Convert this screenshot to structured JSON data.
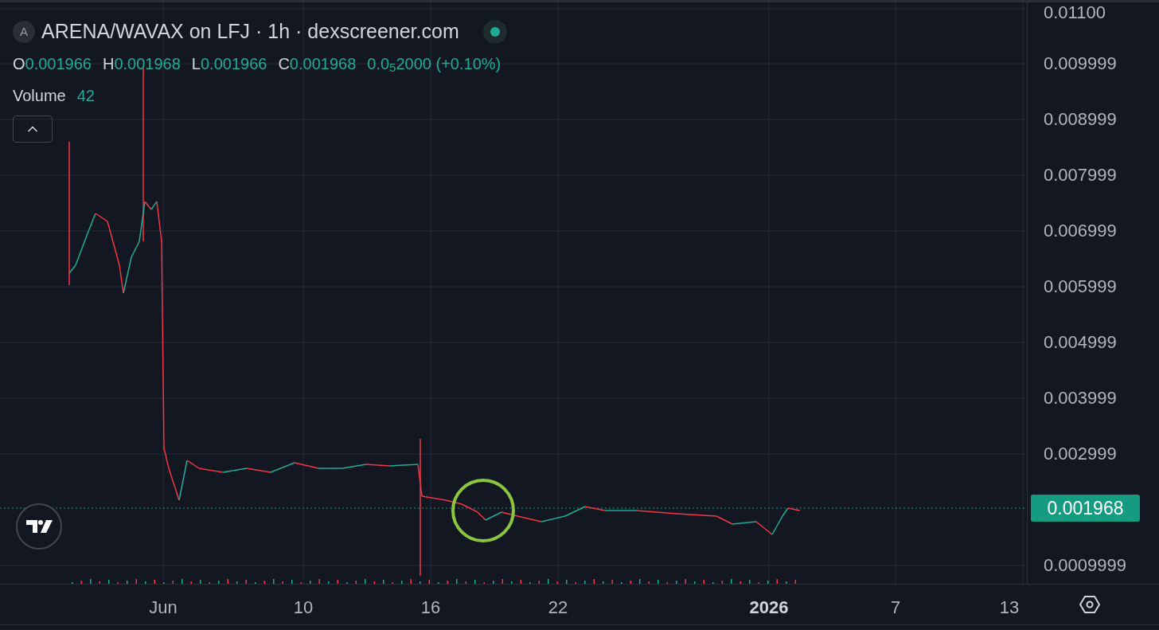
{
  "header": {
    "avatar": "A",
    "title": "ARENA/WAVAX on LFJ · 1h · dexscreener.com",
    "live": true
  },
  "ohlc": [
    {
      "label": "O",
      "value": "0.001966"
    },
    {
      "label": "H",
      "value": "0.001968"
    },
    {
      "label": "L",
      "value": "0.001966"
    },
    {
      "label": "C",
      "value": "0.001968"
    }
  ],
  "change": "0.0$_{5}$2000 (+0.10%)",
  "volume": {
    "label": "Volume",
    "value": "42"
  },
  "price_axis": [
    "0.01100",
    "0.009999",
    "0.008999",
    "0.007999",
    "0.006999",
    "0.005999",
    "0.004999",
    "0.003999",
    "0.002999",
    "0.0009999"
  ],
  "current_price": "0.001968",
  "time_axis": [
    {
      "label": "Jun",
      "bold": false
    },
    {
      "label": "10",
      "bold": false
    },
    {
      "label": "16",
      "bold": false
    },
    {
      "label": "22",
      "bold": false
    },
    {
      "label": "2026",
      "bold": true
    },
    {
      "label": "7",
      "bold": false
    },
    {
      "label": "13",
      "bold": false
    }
  ]
}
